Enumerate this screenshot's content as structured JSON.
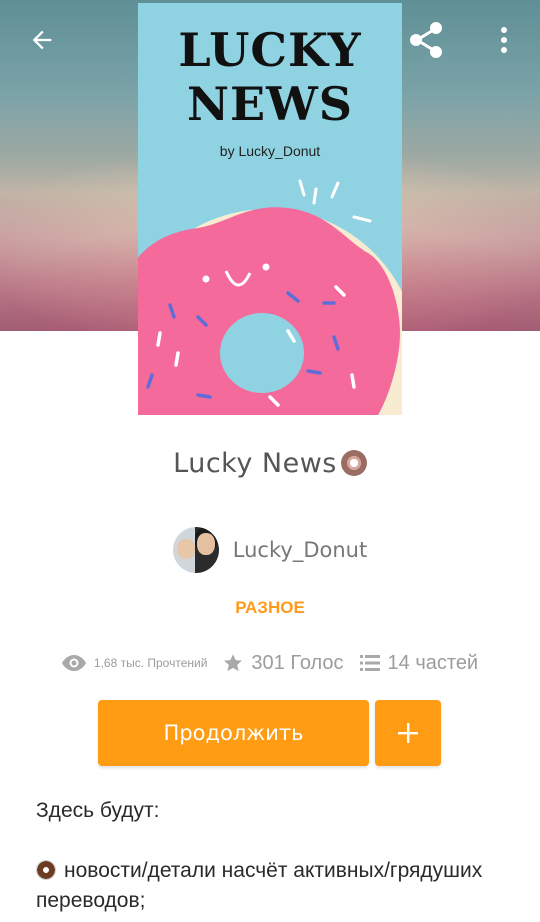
{
  "topbar": {
    "back_icon": "arrow-left-icon",
    "share_icon": "share-icon",
    "more_icon": "more-vertical-icon"
  },
  "cover": {
    "title_line1": "LUCKY",
    "title_line2": "NEWS",
    "byline": "by Lucky_Donut",
    "colors": {
      "background": "#8fd3e2",
      "icing": "#f46a9b",
      "dough": "#f7ecd2"
    }
  },
  "story": {
    "title": "Lucky News",
    "title_emoji": "donut-emoji-icon"
  },
  "author": {
    "name": "Lucky_Donut",
    "avatar_icon": "avatar-image"
  },
  "category": "РАЗНОЕ",
  "stats": {
    "reads": "1,68 тыс. Прочтений",
    "votes": "301 Голос",
    "parts": "14 частей"
  },
  "actions": {
    "continue_label": "Продолжить",
    "add_label": "+"
  },
  "description": {
    "line1": "Здесь будут:",
    "bullet1": "новости/детали насчёт активных/грядуших переводов;"
  },
  "colors": {
    "accent": "#ff9c13",
    "category": "#ff9a1a",
    "muted": "#9c9c9c"
  }
}
